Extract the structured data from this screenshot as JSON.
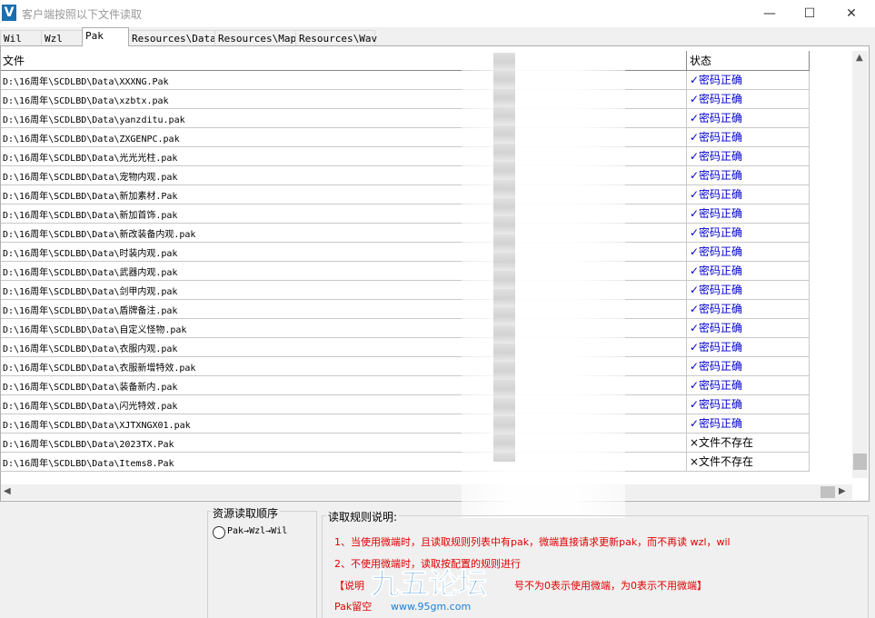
{
  "window": {
    "title": "客户端按照以下文件读取",
    "app_icon_letter": "V"
  },
  "tabs": [
    "Wil",
    "Wzl",
    "Pak",
    "Resources\\Data",
    "Resources\\Map",
    "Resources\\Wav"
  ],
  "active_tab": "Pak",
  "table": {
    "headers": {
      "file": "文件",
      "status": "状态"
    },
    "rows": [
      {
        "path": "D:\\16周年\\SCDLBD\\Data\\XXXNG.Pak",
        "status": "✓密码正确"
      },
      {
        "path": "D:\\16周年\\SCDLBD\\Data\\xzbtx.pak",
        "status": "✓密码正确"
      },
      {
        "path": "D:\\16周年\\SCDLBD\\Data\\yanzditu.pak",
        "status": "✓密码正确"
      },
      {
        "path": "D:\\16周年\\SCDLBD\\Data\\ZXGENPC.pak",
        "status": "✓密码正确"
      },
      {
        "path": "D:\\16周年\\SCDLBD\\Data\\光光光柱.pak",
        "status": "✓密码正确"
      },
      {
        "path": "D:\\16周年\\SCDLBD\\Data\\宠物内观.pak",
        "status": "✓密码正确"
      },
      {
        "path": "D:\\16周年\\SCDLBD\\Data\\新加素材.Pak",
        "status": "✓密码正确"
      },
      {
        "path": "D:\\16周年\\SCDLBD\\Data\\新加首饰.pak",
        "status": "✓密码正确"
      },
      {
        "path": "D:\\16周年\\SCDLBD\\Data\\新改装备内观.pak",
        "status": "✓密码正确"
      },
      {
        "path": "D:\\16周年\\SCDLBD\\Data\\时装内观.pak",
        "status": "✓密码正确"
      },
      {
        "path": "D:\\16周年\\SCDLBD\\Data\\武器内观.pak",
        "status": "✓密码正确"
      },
      {
        "path": "D:\\16周年\\SCDLBD\\Data\\剑甲内观.pak",
        "status": "✓密码正确"
      },
      {
        "path": "D:\\16周年\\SCDLBD\\Data\\盾牌备注.pak",
        "status": "✓密码正确"
      },
      {
        "path": "D:\\16周年\\SCDLBD\\Data\\自定义怪物.pak",
        "status": "✓密码正确"
      },
      {
        "path": "D:\\16周年\\SCDLBD\\Data\\衣服内观.pak",
        "status": "✓密码正确"
      },
      {
        "path": "D:\\16周年\\SCDLBD\\Data\\衣服新增特效.pak",
        "status": "✓密码正确"
      },
      {
        "path": "D:\\16周年\\SCDLBD\\Data\\装备新内.pak",
        "status": "✓密码正确"
      },
      {
        "path": "D:\\16周年\\SCDLBD\\Data\\闪光特效.pak",
        "status": "✓密码正确"
      },
      {
        "path": "D:\\16周年\\SCDLBD\\Data\\XJTXNGX01.pak",
        "status": "✓密码正确"
      },
      {
        "path": "D:\\16周年\\SCDLBD\\Data\\2023TX.Pak",
        "status": "×文件不存在"
      },
      {
        "path": "D:\\16周年\\SCDLBD\\Data\\Items8.Pak",
        "status": "×文件不存在"
      }
    ]
  },
  "status_colors": {
    "ok": "#0000cc",
    "missing": "#000000"
  },
  "read_order": {
    "title": "资源读取顺序",
    "option": "Pak→Wzl→Wil"
  },
  "rules": {
    "title": "读取规则说明:",
    "line1": "1、当使用微端时，且读取规则列表中有pak，微端直接请求更新pak，而不再读 wzl，wil",
    "line2": "2、不使用微端时，读取按配置的规则进行",
    "line3a": "【说明",
    "line3b": "号不为0表示使用微端，为0表示不用微端】",
    "line4": "Pak留空"
  },
  "watermark": {
    "text": "九五论坛",
    "sub": "www.95gm.com"
  }
}
